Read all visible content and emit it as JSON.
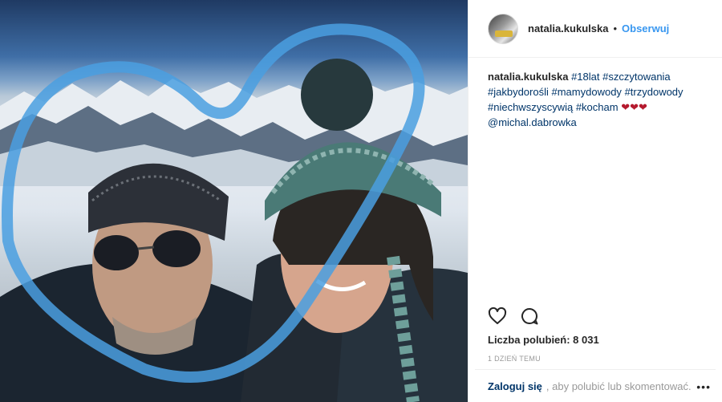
{
  "post": {
    "image_alt": "",
    "photo_icon": "selfie-photo"
  },
  "header": {
    "username": "natalia.kukulska",
    "separator": "•",
    "follow_label": "Obserwuj"
  },
  "caption": {
    "username": "natalia.kukulska",
    "tags": [
      "#18lat",
      "#szczytowania",
      "#jakbydorośli",
      "#mamydowody",
      "#trzydowody",
      "#niechwszyscywią",
      "#kocham"
    ],
    "hearts": "❤❤❤",
    "mention": "@michal.dabrowka"
  },
  "actions": {
    "like_icon": "heart-icon",
    "comment_icon": "comment-icon"
  },
  "likes": {
    "label": "Liczba polubień: 8 031"
  },
  "time": {
    "label": "1 DZIEŃ TEMU"
  },
  "footer": {
    "login_label": "Zaloguj się",
    "rest_text": ", aby polubić lub skomentować.",
    "more_label": "•••"
  },
  "colors": {
    "link": "#003569",
    "follow": "#3897f0",
    "heart_emoji": "#b51a2e"
  }
}
